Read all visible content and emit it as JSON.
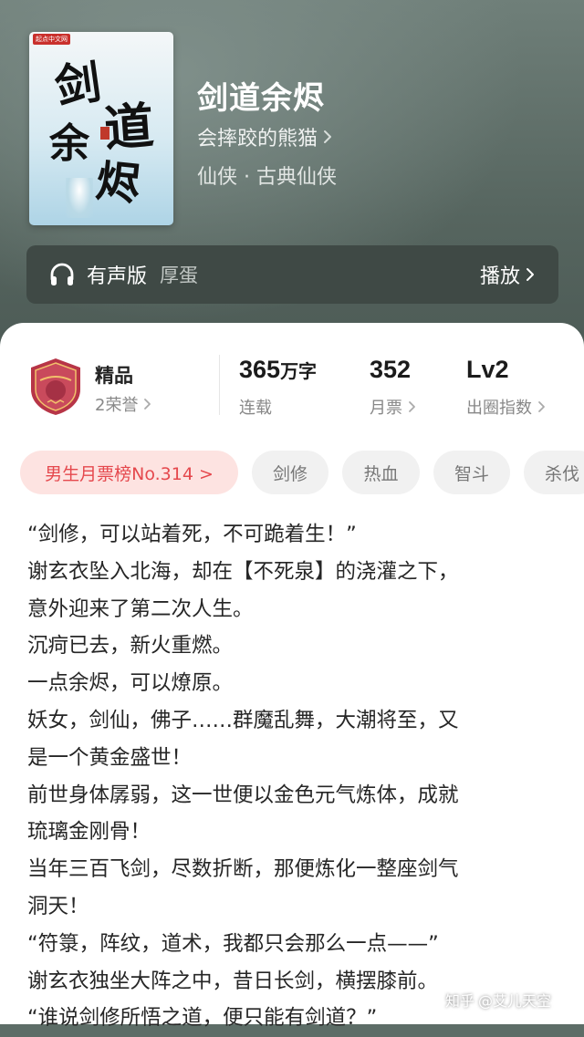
{
  "book": {
    "title": "剑道余烬",
    "author": "会摔跤的熊猫",
    "genre": "仙侠 · 古典仙侠",
    "cover": {
      "title_chars": [
        "剑",
        "道",
        "余",
        "烬"
      ],
      "publisher_badge": "起点中文网"
    }
  },
  "audio": {
    "icon": "headphones-icon",
    "label": "有声版",
    "narrator": "厚蛋",
    "play_label": "播放"
  },
  "stats": {
    "badge_icon": "premium-channel-badge-icon",
    "premium_label": "精品",
    "honor": "2荣誉",
    "word_count": "365",
    "word_unit": "万字",
    "status": "连载",
    "monthly_tickets": "352",
    "tickets_label": "月票",
    "level": "Lv2",
    "level_label": "出圈指数"
  },
  "tags": [
    "男生月票榜No.314 >",
    "剑修",
    "热血",
    "智斗",
    "杀伐"
  ],
  "synopsis": [
    "“剑修，可以站着死，不可跪着生！”",
    "谢玄衣坠入北海，却在【不死泉】的浇灌之下，",
    "意外迎来了第二次人生。",
    "沉疴已去，新火重燃。",
    "一点余烬，可以燎原。",
    "妖女，剑仙，佛子……群魔乱舞，大潮将至，又",
    "是一个黄金盛世！",
    "前世身体孱弱，这一世便以金色元气炼体，成就",
    "琉璃金刚骨！",
    "当年三百飞剑，尽数折断，那便炼化一整座剑气",
    "洞天！",
    "“符箓，阵纹，道术，我都只会那么一点——”",
    "谢玄衣独坐大阵之中，昔日长剑，横摆膝前。",
    "“谁说剑修所悟之道，便只能有剑道？”"
  ],
  "watermark": {
    "site": "知乎",
    "user": "@艾儿天空"
  },
  "colors": {
    "header": "#5d6d67",
    "audio_bar": "#3f4945",
    "rank_chip_bg": "#fde3e1",
    "rank_chip_text": "#e5484d",
    "tag_bg": "#f1f1f1"
  }
}
